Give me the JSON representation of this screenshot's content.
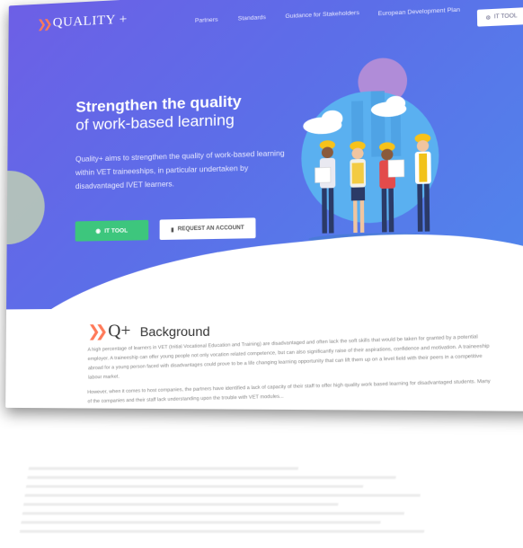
{
  "nav": {
    "logo": "QUALITY +",
    "items": [
      "Partners",
      "Standards",
      "Guidance for Stakeholders",
      "European Development Plan"
    ],
    "it_tool": "IT TOOL"
  },
  "hero": {
    "title_line1": "Strengthen the quality",
    "title_line2": "of work-based learning",
    "intro": "Quality+ aims to strengthen the quality of work-based learning within VET traineeships, in particular undertaken by disadvantaged IVET learners.",
    "btn_it_tool": "IT TOOL",
    "btn_request": "REQUEST AN ACCOUNT"
  },
  "background": {
    "logo_text": "Q+",
    "heading": "Background",
    "paragraphs": [
      "A high percentage of learners in VET (Initial Vocational Education and Training) are disadvantaged and often lack the soft skills that would be taken for granted by a potential employer. A traineeship can offer young people not only vocation related competence, but can also significantly raise of their aspirations, confidence and motivation. A traineeship abroad for a young person faced with disadvantages could prove to be a life changing learning opportunity that can lift them up on a level field with their peers in a competitive labour market.",
      "However, when it comes to host companies, the partners have identified a lack of capacity of their staff to offer high quality work based learning for disadvantaged students. Many of the companies and their staff lack understanding upon the trouble with VET modules..."
    ]
  },
  "colors": {
    "hero_start": "#6d5fe6",
    "hero_end": "#4f88ec",
    "accent_orange": "#ff7a59",
    "button_green": "#3dc67d"
  }
}
